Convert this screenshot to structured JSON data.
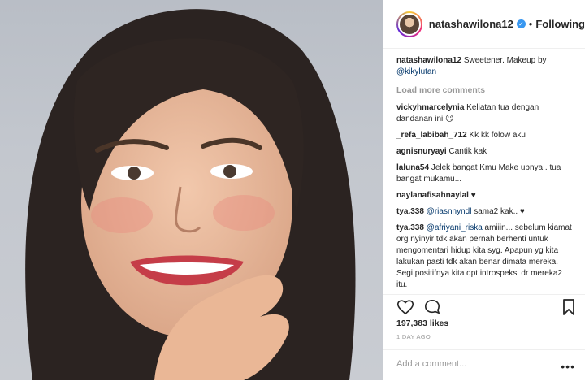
{
  "post": {
    "username": "natashawilona12",
    "follow_status": "Following",
    "separator": "•",
    "caption_user": "natashawilona12",
    "caption_text": "Sweetener. Makeup by",
    "caption_mention": "@kikylutan",
    "load_more": "Load more comments",
    "likes": "197,383 likes",
    "time_ago": "1 DAY AGO",
    "add_comment_placeholder": "Add a comment...",
    "more_options": "•••"
  },
  "comments": [
    {
      "user": "vickyhmarcelynia",
      "text": "Keliatan tua dengan dandanan ini ☹"
    },
    {
      "user": "_refa_labibah_712",
      "text": "Kk kk folow aku"
    },
    {
      "user": "agnisnuryayi",
      "text": "Cantik kak"
    },
    {
      "user": "laluna54",
      "text": "Jelek bangat Kmu Make upnya.. tua bangat mukamu..."
    },
    {
      "user": "naylanafisahnaylal",
      "text": "♥"
    },
    {
      "user": "tya.338",
      "mention": "@riasnnyndl",
      "text": "sama2 kak.. ♥"
    },
    {
      "user": "tya.338",
      "mention": "@afriyani_riska",
      "text": "amiiin... sebelum kiamat org nyinyir tdk akan pernah berhenti untuk mengomentari hidup kita syg. Apapun yg kita lakukan pasti tdk akan benar dimata mereka. Segi positifnya kita dpt introspeksi dr mereka2 itu."
    }
  ],
  "icons": [
    "heart-icon",
    "comment-icon",
    "bookmark-icon",
    "verified-badge-icon"
  ],
  "colors": {
    "link": "#003569",
    "muted": "#999999",
    "verified": "#3897f0"
  }
}
